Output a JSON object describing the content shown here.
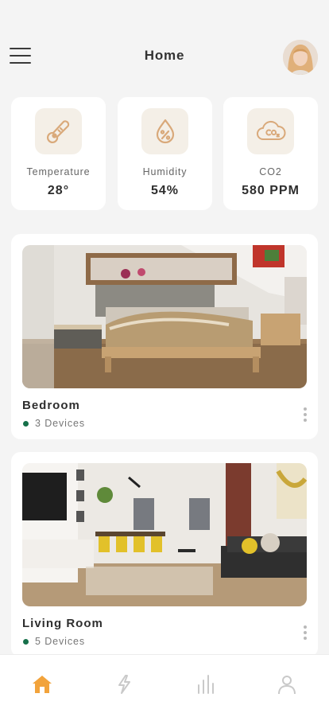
{
  "header": {
    "title": "Home",
    "menu_icon": "hamburger-menu-icon",
    "avatar_icon": "user-avatar"
  },
  "stats": [
    {
      "label": "Temperature",
      "value": "28°",
      "icon": "thermometer-icon"
    },
    {
      "label": "Humidity",
      "value": "54%",
      "icon": "humidity-drop-icon"
    },
    {
      "label": "CO2",
      "value": "580 PPM",
      "icon": "co2-cloud-icon"
    }
  ],
  "rooms": [
    {
      "name": "Bedroom",
      "devices": "3 Devices",
      "image": "bedroom-photo"
    },
    {
      "name": "Living Room",
      "devices": "5 Devices",
      "image": "living-room-photo"
    }
  ],
  "bottom_nav": [
    {
      "icon": "home-icon",
      "active": true
    },
    {
      "icon": "lightning-icon",
      "active": false
    },
    {
      "icon": "bar-chart-icon",
      "active": false
    },
    {
      "icon": "profile-icon",
      "active": false
    }
  ],
  "colors": {
    "accent": "#f2a33b",
    "status_online": "#16704a",
    "icon_tint": "#d9a97a",
    "icon_bg": "#f4efe7",
    "nav_inactive": "#c9c9c9"
  }
}
